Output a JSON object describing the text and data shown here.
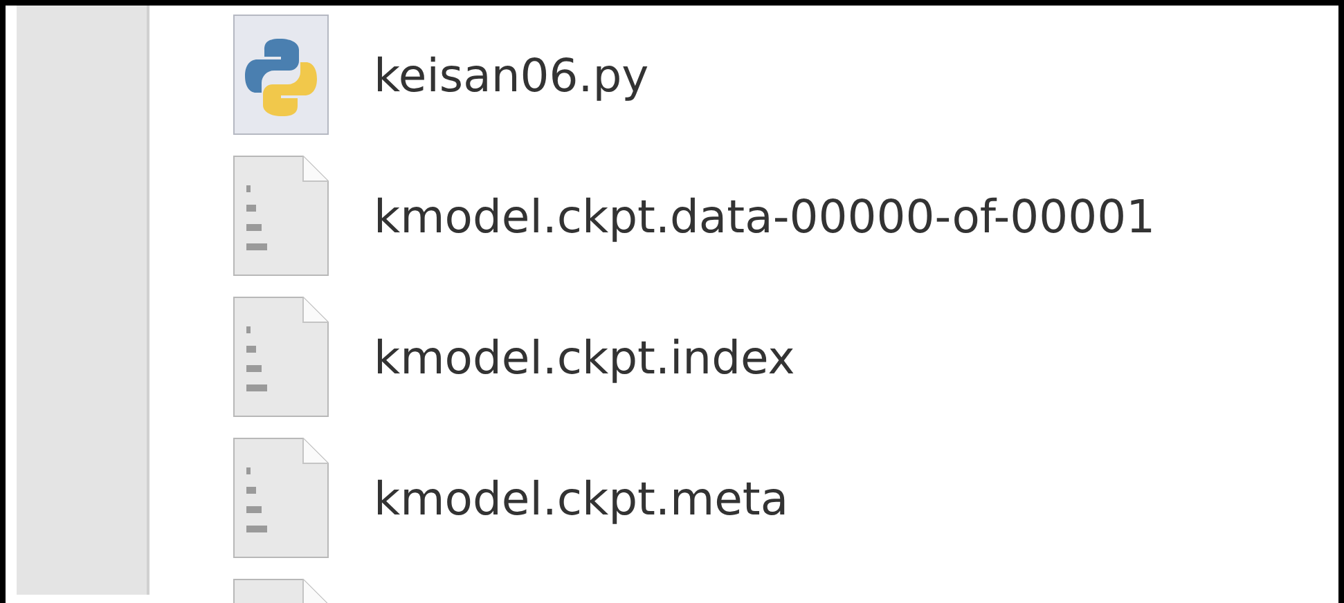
{
  "files": [
    {
      "kind": "python",
      "name": "keisan06.py"
    },
    {
      "kind": "binary",
      "name": "kmodel.ckpt.data-00000-of-00001"
    },
    {
      "kind": "binary",
      "name": "kmodel.ckpt.index"
    },
    {
      "kind": "binary",
      "name": "kmodel.ckpt.meta"
    },
    {
      "kind": "binary"
    }
  ]
}
